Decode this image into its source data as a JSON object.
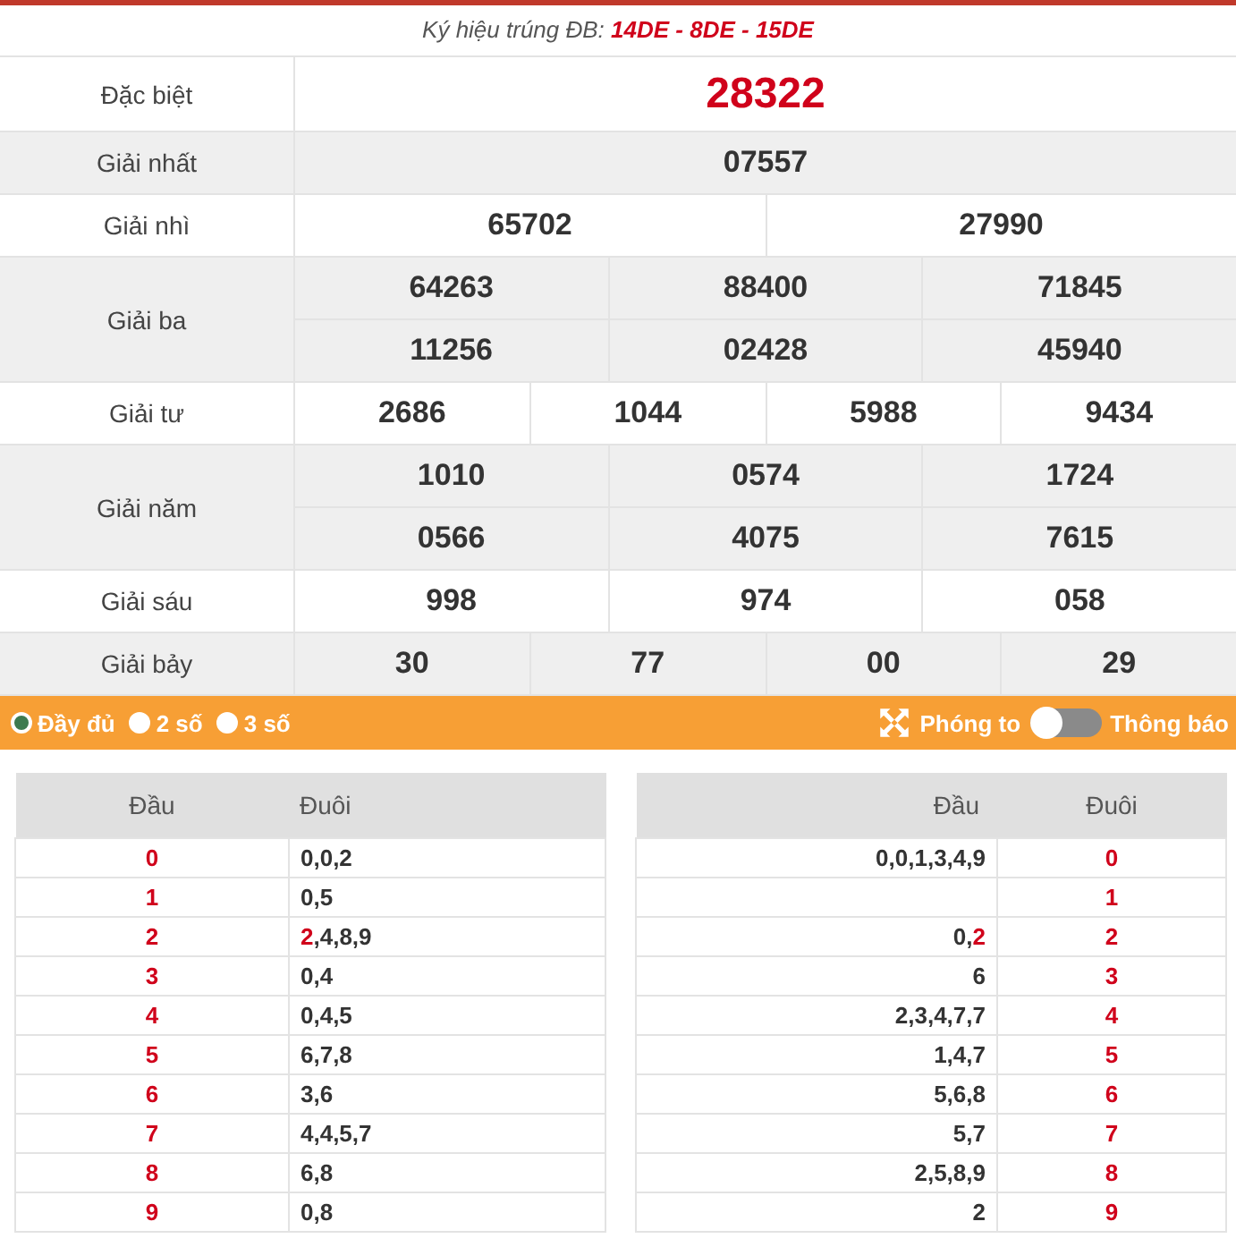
{
  "header": {
    "label": "Ký hiệu trúng ĐB:",
    "codes": "14DE - 8DE - 15DE"
  },
  "prizes": [
    {
      "name": "Đặc biệt",
      "kind": "special",
      "lines": [
        [
          "28322"
        ]
      ]
    },
    {
      "name": "Giải nhất",
      "kind": "normal",
      "lines": [
        [
          "07557"
        ]
      ]
    },
    {
      "name": "Giải nhì",
      "kind": "normal",
      "lines": [
        [
          "65702",
          "27990"
        ]
      ]
    },
    {
      "name": "Giải ba",
      "kind": "normal",
      "lines": [
        [
          "64263",
          "88400",
          "71845"
        ],
        [
          "11256",
          "02428",
          "45940"
        ]
      ]
    },
    {
      "name": "Giải tư",
      "kind": "normal",
      "lines": [
        [
          "2686",
          "1044",
          "5988",
          "9434"
        ]
      ]
    },
    {
      "name": "Giải năm",
      "kind": "normal",
      "lines": [
        [
          "1010",
          "0574",
          "1724"
        ],
        [
          "0566",
          "4075",
          "7615"
        ]
      ]
    },
    {
      "name": "Giải sáu",
      "kind": "normal",
      "lines": [
        [
          "998",
          "974",
          "058"
        ]
      ]
    },
    {
      "name": "Giải bảy",
      "kind": "normal",
      "lines": [
        [
          "30",
          "77",
          "00",
          "29"
        ]
      ]
    }
  ],
  "toolbar": {
    "options": [
      {
        "label": "Đầy đủ",
        "selected": true
      },
      {
        "label": "2 số",
        "selected": false
      },
      {
        "label": "3 số",
        "selected": false
      }
    ],
    "zoom": "Phóng to",
    "notify": {
      "label": "Thông báo",
      "on": false
    }
  },
  "loto_head": {
    "columns": [
      "Đầu",
      "Đuôi"
    ],
    "rows": [
      {
        "key": "0",
        "values": "0,0,2"
      },
      {
        "key": "1",
        "values": "0,5"
      },
      {
        "key": "2",
        "values": "**2**,4,8,9"
      },
      {
        "key": "3",
        "values": "0,4"
      },
      {
        "key": "4",
        "values": "0,4,5"
      },
      {
        "key": "5",
        "values": "6,7,8"
      },
      {
        "key": "6",
        "values": "3,6"
      },
      {
        "key": "7",
        "values": "4,4,5,7"
      },
      {
        "key": "8",
        "values": "6,8"
      },
      {
        "key": "9",
        "values": "0,8"
      }
    ]
  },
  "loto_tail": {
    "columns": [
      "Đầu",
      "Đuôi"
    ],
    "rows": [
      {
        "key": "0",
        "values": "0,0,1,3,4,9"
      },
      {
        "key": "1"
      },
      {
        "key": "2",
        "values": "0,**2**"
      },
      {
        "key": "3",
        "values": "6"
      },
      {
        "key": "4",
        "values": "2,3,4,7,7"
      },
      {
        "key": "5",
        "values": "1,4,7"
      },
      {
        "key": "6",
        "values": "5,6,8"
      },
      {
        "key": "7",
        "values": "5,7"
      },
      {
        "key": "8",
        "values": "2,5,8,9"
      },
      {
        "key": "9",
        "values": "2"
      }
    ]
  }
}
